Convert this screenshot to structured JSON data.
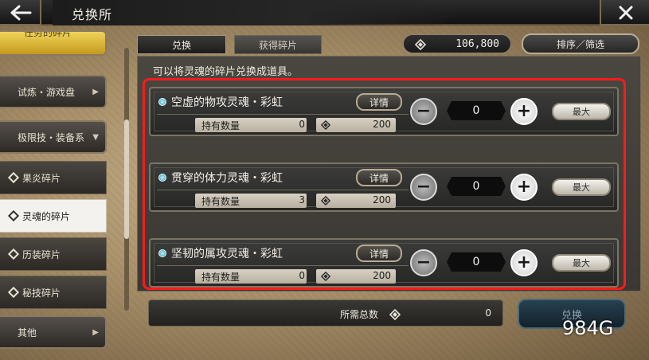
{
  "header": {
    "title": "兑换所"
  },
  "sidebar": {
    "top_item": "任务的碎片",
    "items": [
      {
        "label": "试炼・游戏盘",
        "kind": "category"
      },
      {
        "label": "极限技・装备系",
        "kind": "category-open"
      },
      {
        "label": "果炎碎片",
        "kind": "sub"
      },
      {
        "label": "灵魂的碎片",
        "kind": "sub-active"
      },
      {
        "label": "历装碎片",
        "kind": "sub"
      },
      {
        "label": "秘技碎片",
        "kind": "sub"
      },
      {
        "label": "其他",
        "kind": "category"
      }
    ]
  },
  "tabs": [
    {
      "label": "兑换",
      "active": true
    },
    {
      "label": "获得碎片",
      "active": false
    }
  ],
  "currency": {
    "value": "106,800",
    "icon": "gem-icon"
  },
  "sort_filter_label": "排序／筛选",
  "hint": "可以将灵魂的碎片兑换成道具。",
  "items": [
    {
      "name": "空虚的物攻灵魂・彩虹",
      "detail_label": "详情",
      "own_label": "持有数量",
      "own_value": "0",
      "cost": "200",
      "quantity": "0",
      "max_label": "最大"
    },
    {
      "name": "贯穿的体力灵魂・彩虹",
      "detail_label": "详情",
      "own_label": "持有数量",
      "own_value": "3",
      "cost": "200",
      "quantity": "0",
      "max_label": "最大"
    },
    {
      "name": "坚韧的属攻灵魂・彩虹",
      "detail_label": "详情",
      "own_label": "持有数量",
      "own_value": "0",
      "cost": "200",
      "quantity": "0",
      "max_label": "最大"
    }
  ],
  "footer": {
    "total_label": "所需总数",
    "total_value": "0",
    "exchange_label": "兑换"
  },
  "watermark": "984G",
  "colors": {
    "highlight": "#ff1a1a",
    "accent_gold": "#d9b23a",
    "exchange_disabled": "#274150"
  }
}
